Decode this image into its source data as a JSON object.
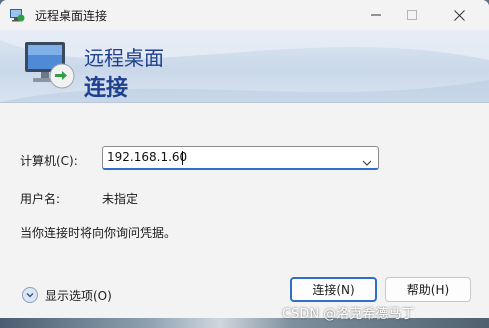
{
  "window": {
    "title": "远程桌面连接",
    "minimize_icon": "minimize-icon",
    "maximize_icon": "maximize-icon",
    "close_icon": "close-icon"
  },
  "banner": {
    "line1": "远程桌面",
    "line2": "连接",
    "icon": "remote-desktop-monitor-icon"
  },
  "form": {
    "computer_label": "计算机(C):",
    "computer_value": "192.168.1.60",
    "user_label": "用户名:",
    "user_value": "未指定",
    "hint": "当你连接时将向你询问凭据。"
  },
  "footer": {
    "options_label": "显示选项(O)",
    "connect_label": "连接(N)",
    "help_label": "帮助(H)"
  },
  "watermark": "CSDN @洛克希德马丁",
  "colors": {
    "accent": "#2f6fc9",
    "banner_text": "#1f3f8f"
  }
}
